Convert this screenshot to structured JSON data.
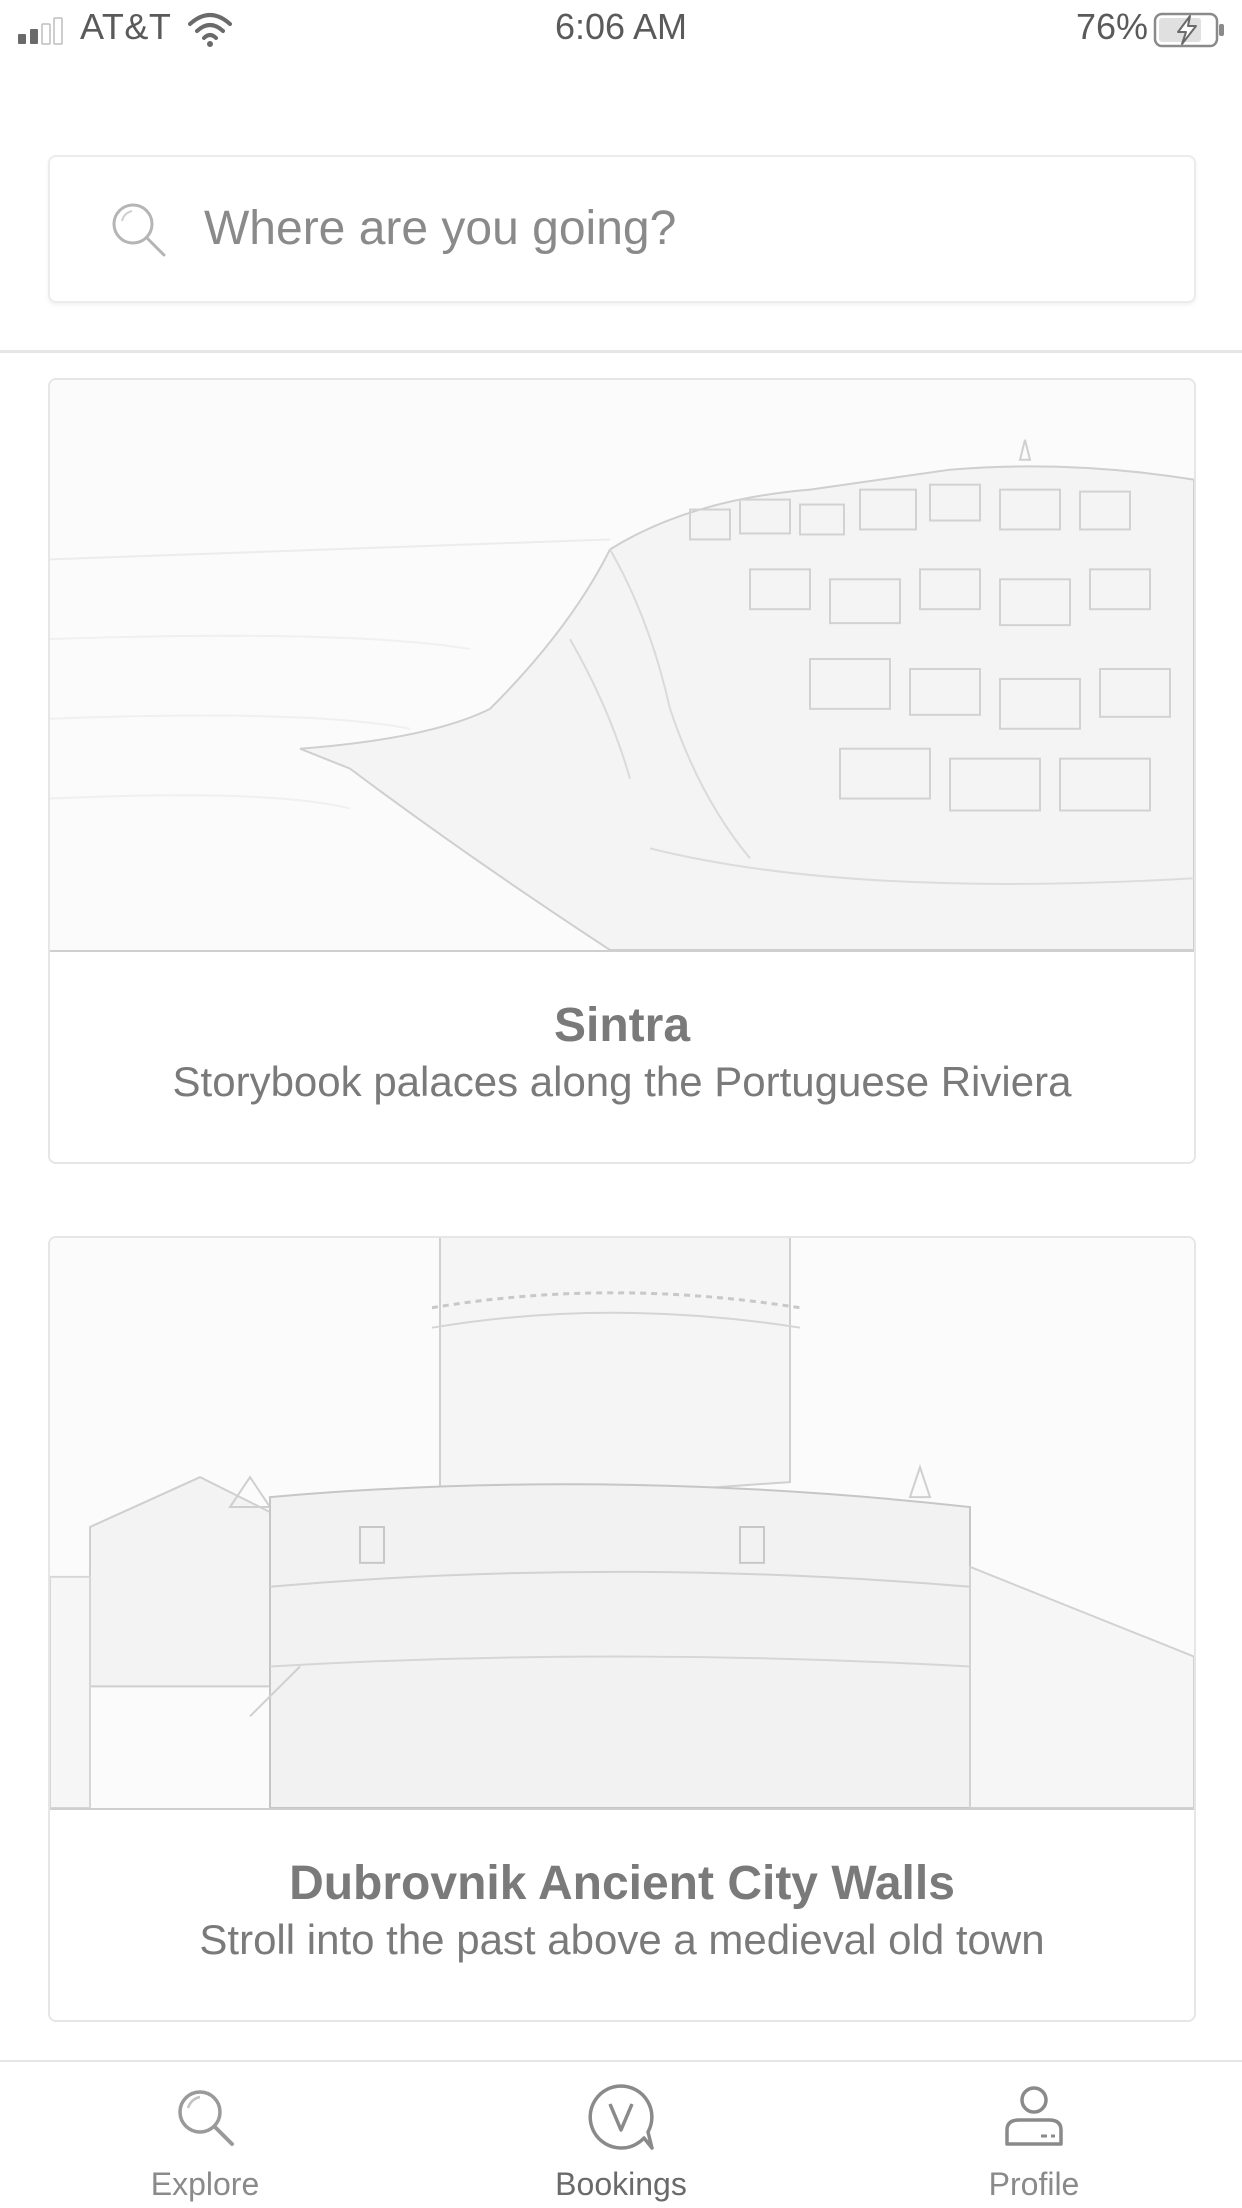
{
  "status_bar": {
    "carrier": "AT&T",
    "time": "6:06 AM",
    "battery": "76%",
    "icons": [
      "signal-icon",
      "wifi-icon",
      "battery-charging-icon"
    ]
  },
  "search": {
    "placeholder": "Where are you going?",
    "icon": "search-icon"
  },
  "cards": [
    {
      "title": "Sintra",
      "subtitle": "Storybook palaces along the Portuguese Riviera",
      "image": "coastal-cliff-town-photo"
    },
    {
      "title": "Dubrovnik Ancient City Walls",
      "subtitle": "Stroll into the past above a medieval old town",
      "image": "fortress-tower-photo"
    }
  ],
  "tab_bar": {
    "tabs": [
      {
        "label": "Explore",
        "icon": "explore-icon"
      },
      {
        "label": "Bookings",
        "icon": "bookings-icon"
      },
      {
        "label": "Profile",
        "icon": "profile-icon"
      }
    ]
  }
}
